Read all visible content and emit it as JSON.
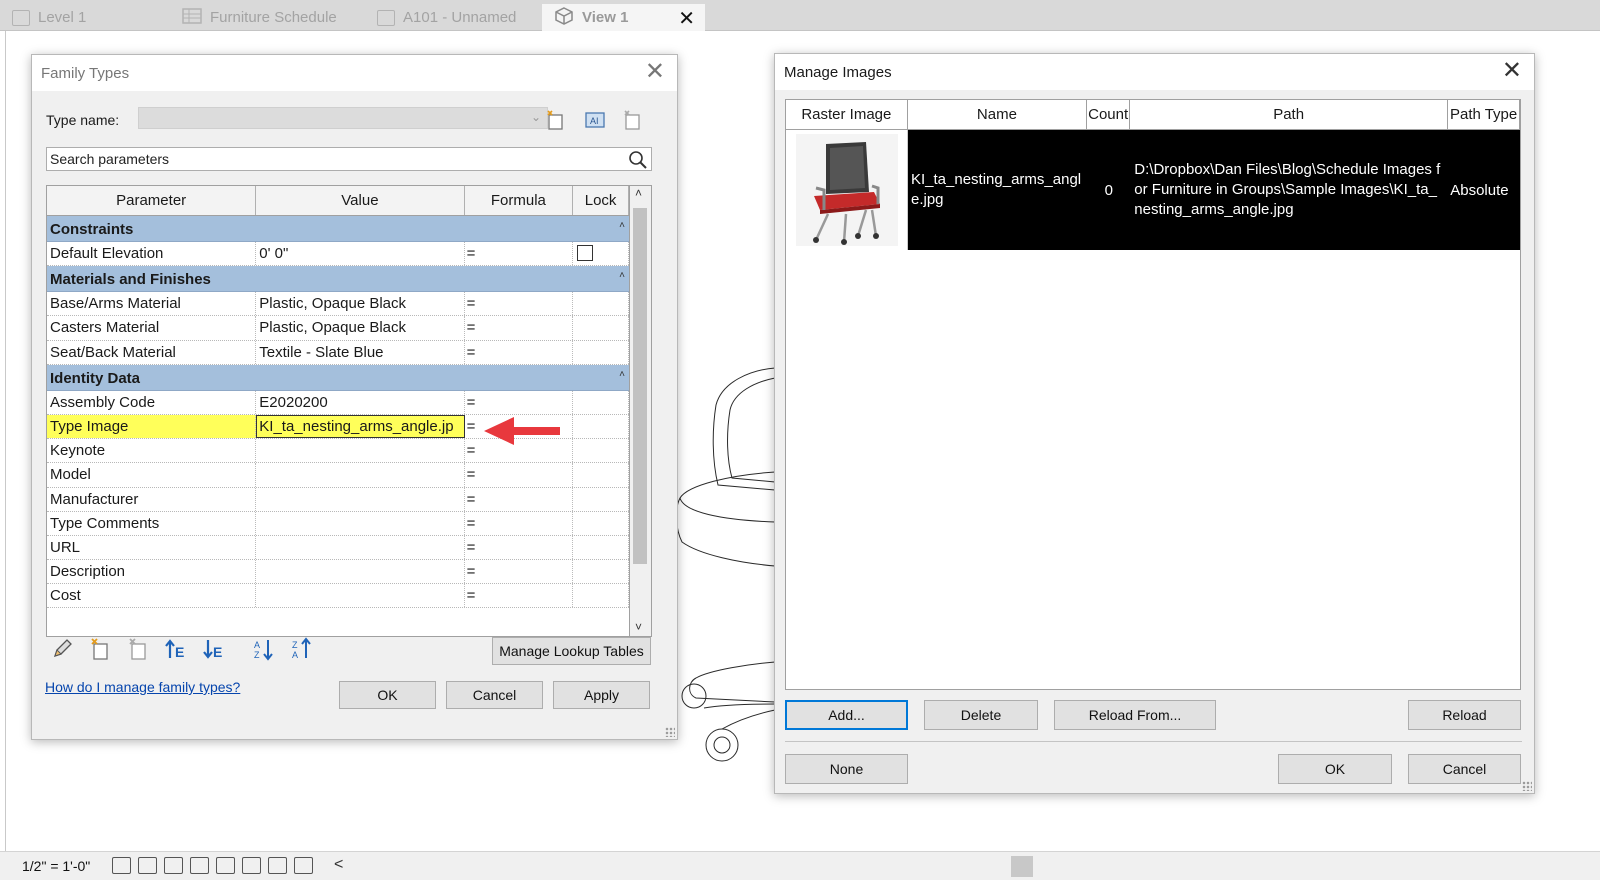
{
  "tabs": [
    {
      "label": "Level 1"
    },
    {
      "label": "Furniture Schedule"
    },
    {
      "label": "A101 - Unnamed"
    },
    {
      "label": "View 1",
      "active": true
    }
  ],
  "tab_close_glyph": "✕",
  "family_types": {
    "title": "Family Types",
    "type_name_label": "Type name:",
    "search_placeholder": "Search parameters",
    "columns": {
      "parameter": "Parameter",
      "value": "Value",
      "formula": "Formula",
      "lock": "Lock"
    },
    "groups": {
      "constraints": {
        "name": "Constraints",
        "rows": [
          {
            "parameter": "Default Elevation",
            "value": "0'  0\"",
            "formula": "=",
            "lock": true
          }
        ]
      },
      "materials": {
        "name": "Materials and Finishes",
        "rows": [
          {
            "parameter": "Base/Arms Material",
            "value": "Plastic, Opaque Black",
            "formula": "="
          },
          {
            "parameter": "Casters Material",
            "value": "Plastic, Opaque Black",
            "formula": "="
          },
          {
            "parameter": "Seat/Back Material",
            "value": "Textile - Slate Blue",
            "formula": "="
          }
        ]
      },
      "identity": {
        "name": "Identity Data",
        "rows": [
          {
            "parameter": "Assembly Code",
            "value": "E2020200",
            "formula": "="
          },
          {
            "parameter": "Type Image",
            "value": "KI_ta_nesting_arms_angle.jp",
            "formula": "="
          },
          {
            "parameter": "Keynote",
            "value": "",
            "formula": "="
          },
          {
            "parameter": "Model",
            "value": "",
            "formula": "="
          },
          {
            "parameter": "Manufacturer",
            "value": "",
            "formula": "="
          },
          {
            "parameter": "Type Comments",
            "value": "",
            "formula": "="
          },
          {
            "parameter": "URL",
            "value": "",
            "formula": "="
          },
          {
            "parameter": "Description",
            "value": "",
            "formula": "="
          },
          {
            "parameter": "Cost",
            "value": "",
            "formula": "="
          }
        ]
      }
    },
    "manage_lookup_label": "Manage Lookup Tables",
    "help_link": "How do I manage family types?",
    "ok_label": "OK",
    "cancel_label": "Cancel",
    "apply_label": "Apply"
  },
  "manage_images": {
    "title": "Manage Images",
    "columns": {
      "raster": "Raster Image",
      "name": "Name",
      "count": "Count",
      "path": "Path",
      "path_type": "Path Type"
    },
    "rows": [
      {
        "name": "KI_ta_nesting_arms_angle.jpg",
        "count": "0",
        "path": "D:\\Dropbox\\Dan Files\\Blog\\Schedule Images for Furniture in Groups\\Sample Images\\KI_ta_nesting_arms_angle.jpg",
        "path_type": "Absolute"
      }
    ],
    "add_label": "Add...",
    "delete_label": "Delete",
    "reload_from_label": "Reload From...",
    "reload_label": "Reload",
    "none_label": "None",
    "ok_label": "OK",
    "cancel_label": "Cancel"
  },
  "status_bar": {
    "scale": "1/2\" = 1'-0\"",
    "chevron": "<"
  },
  "colors": {
    "group_header": "#a4bfdc",
    "highlight": "#ffff5a",
    "arrow": "#e8383d",
    "selected_row": "#000000",
    "focus_border": "#0078d7",
    "link": "#0645ad"
  },
  "icons": {
    "tabs": [
      "floor-plan-icon",
      "schedule-icon",
      "sheet-icon",
      "3d-view-icon"
    ],
    "family_toolbar": [
      "new-type-icon",
      "rename-type-icon",
      "delete-type-icon"
    ],
    "search": "magnifier-icon",
    "bottom_tools": [
      "edit-parameter-icon",
      "new-parameter-icon",
      "delete-parameter-icon",
      "move-up-icon",
      "move-down-icon",
      "sort-ascending-icon",
      "sort-descending-icon"
    ]
  }
}
